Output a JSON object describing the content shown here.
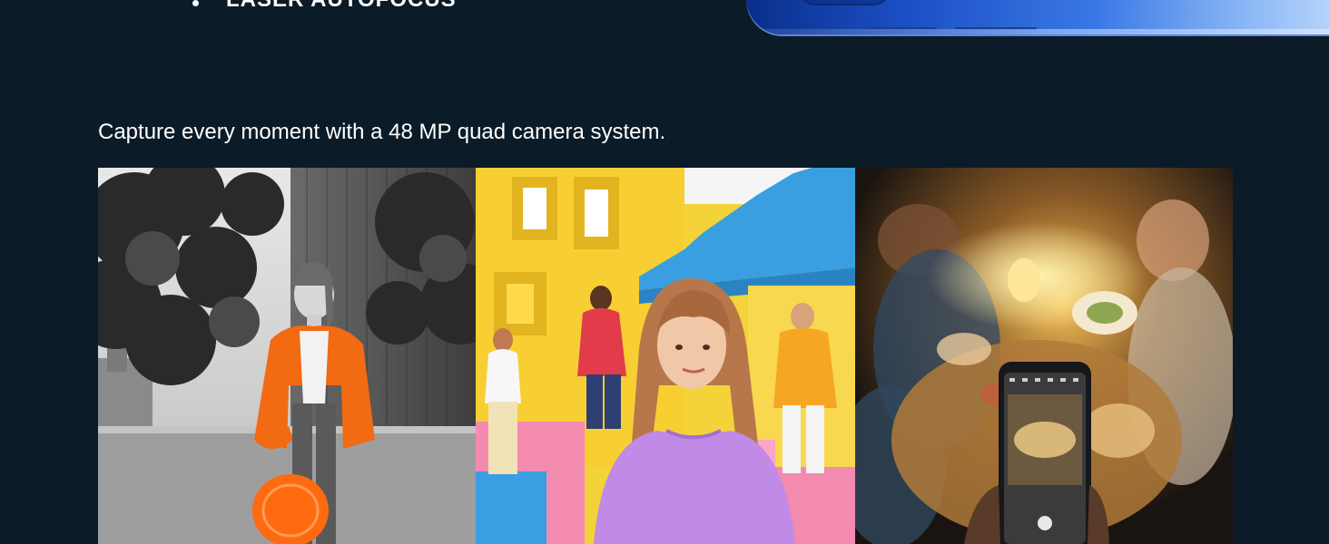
{
  "features": {
    "bullet_text": "LASER AUTOFOCUS"
  },
  "camera_section": {
    "headline": "Capture every moment with a 48 MP quad camera system."
  },
  "gallery": {
    "photos": [
      {
        "name": "selective-color-portrait",
        "subject": "woman in orange jacket holding frisbee"
      },
      {
        "name": "portrait-mode-group",
        "subject": "woman in lilac top in front of colorful building"
      },
      {
        "name": "night-vision-dinner",
        "subject": "phone photographing a dinner table at night"
      }
    ]
  },
  "colors": {
    "background": "#0b1b28",
    "accent_blue": "#1b4fc4",
    "accent_orange": "#f26a12"
  }
}
